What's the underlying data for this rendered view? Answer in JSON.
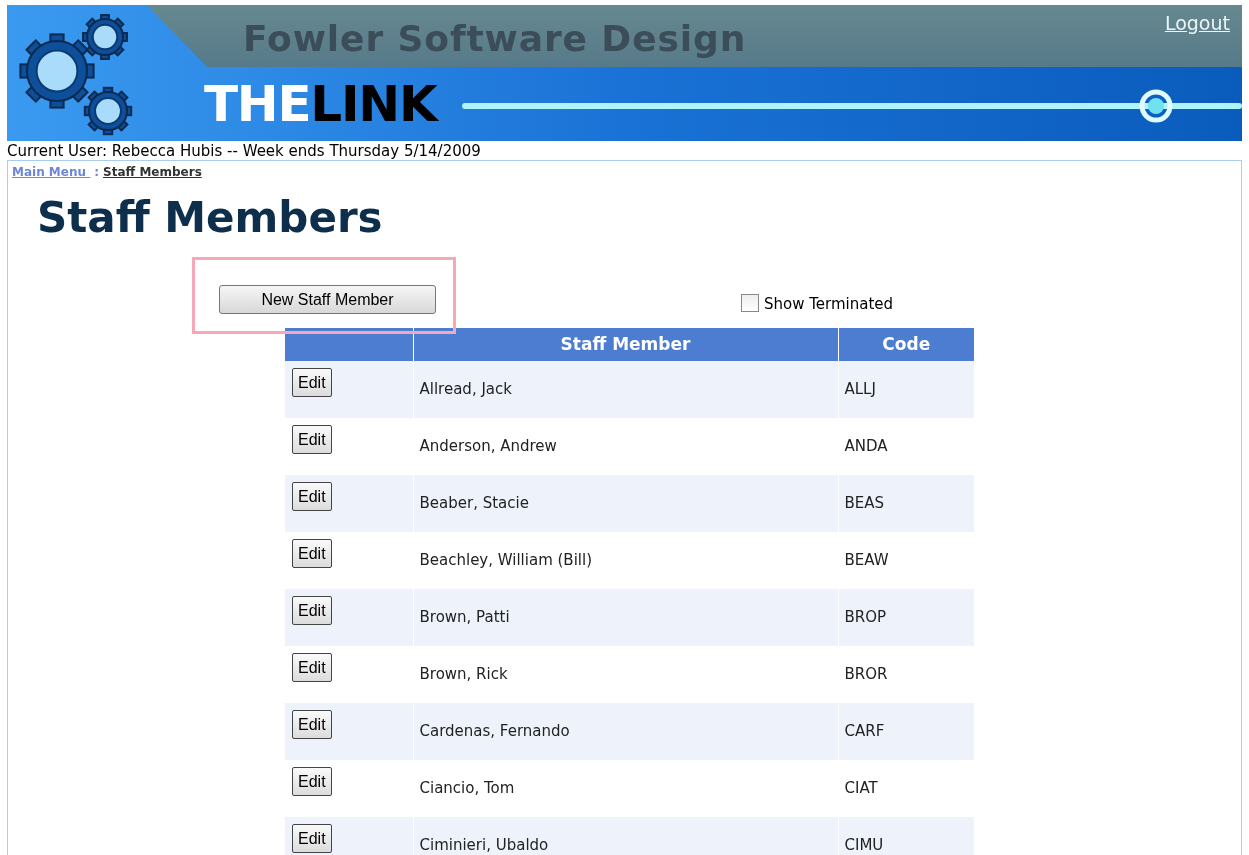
{
  "header": {
    "company": "Fowler Software Design",
    "product_light": "THE",
    "product_dark": "LINK",
    "logout": "Logout"
  },
  "user_line": "Current User: Rebecca Hubis -- Week ends Thursday 5/14/2009",
  "breadcrumb": [
    {
      "label": "Main Menu ",
      "kind": "link"
    },
    {
      "label": ":",
      "kind": "separator"
    },
    {
      "label": "Staff Members",
      "kind": "current"
    }
  ],
  "page_title": "Staff Members",
  "new_button": "New Staff Member",
  "show_terminated": {
    "label": "Show Terminated",
    "checked": false
  },
  "table": {
    "columns": [
      "Staff Member",
      "Code"
    ],
    "rows": [
      {
        "action": "Edit",
        "name": "Allread, Jack",
        "code": "ALLJ"
      },
      {
        "action": "Edit",
        "name": "Anderson, Andrew",
        "code": "ANDA"
      },
      {
        "action": "Edit",
        "name": "Beaber, Stacie",
        "code": "BEAS"
      },
      {
        "action": "Edit",
        "name": "Beachley, William (Bill)",
        "code": "BEAW"
      },
      {
        "action": "Edit",
        "name": "Brown, Patti",
        "code": "BROP"
      },
      {
        "action": "Edit",
        "name": "Brown, Rick",
        "code": "BROR"
      },
      {
        "action": "Edit",
        "name": "Cardenas, Fernando",
        "code": "CARF"
      },
      {
        "action": "Edit",
        "name": "Ciancio, Tom",
        "code": "CIAT"
      },
      {
        "action": "Edit",
        "name": "Ciminieri, Ubaldo",
        "code": "CIMU"
      }
    ]
  }
}
